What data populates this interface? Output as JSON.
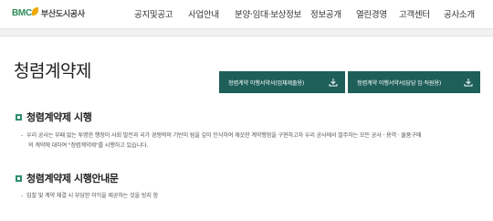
{
  "header": {
    "logo_mark": "BMC",
    "logo_text": "부산도시공사",
    "nav": [
      {
        "label": "공지및공고"
      },
      {
        "label": "사업안내"
      },
      {
        "label": "분양·임대·보상정보"
      },
      {
        "label": "정보공개"
      },
      {
        "label": "열린경영"
      },
      {
        "label": "고객센터"
      },
      {
        "label": "공사소개"
      }
    ]
  },
  "page": {
    "title": "청렴계약제"
  },
  "downloads": [
    {
      "label": "청렴계약 이행서약서(업체제출용)",
      "icon": "download-icon"
    },
    {
      "label": "청렴계약 이행서약서(담당 임·직원용)",
      "icon": "download-icon"
    }
  ],
  "sections": [
    {
      "title": "청렴계약제 시행",
      "lines": [
        "우리 공사는 부패 없는 투명한 행정이 사회 발전과 국가 경쟁력의 기반이 됨을 깊이 인식하여 깨끗한 계약행정을 구현하고자 우리 공사에서 발주하는 모든 공사 · 용역 · 물품구매",
        "의 계약에 대하여 \"청렴계약제\"를 시행하고 있습니다."
      ]
    },
    {
      "title": "청렴계약제 시행안내문",
      "lines": [
        "입찰 및 계약 체결 시 부당한 이익을 제공하는 것을 방지 함"
      ]
    }
  ],
  "colors": {
    "accent": "#1e5f5a",
    "bullet": "#2f8f6c",
    "logo_green": "#2e8b57",
    "logo_yellow": "#f2a800"
  }
}
